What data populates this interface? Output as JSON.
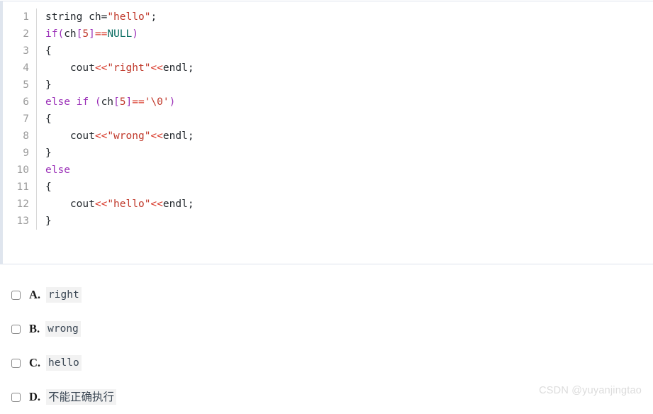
{
  "code_block": {
    "language": "cpp",
    "line_numbers": [
      "1",
      "2",
      "3",
      "4",
      "5",
      "6",
      "7",
      "8",
      "9",
      "10",
      "11",
      "12",
      "13"
    ],
    "lines": [
      {
        "number": "1",
        "text": "string ch=\"hello\";",
        "tokens": [
          {
            "t": "string",
            "c": "plain"
          },
          {
            "t": " ch",
            "c": "plain"
          },
          {
            "t": "=",
            "c": "plain"
          },
          {
            "t": "\"hello\"",
            "c": "str"
          },
          {
            "t": ";",
            "c": "plain"
          }
        ]
      },
      {
        "number": "2",
        "text": "if(ch[5]==NULL)",
        "tokens": [
          {
            "t": "if",
            "c": "kw"
          },
          {
            "t": "(",
            "c": "punc"
          },
          {
            "t": "ch",
            "c": "plain"
          },
          {
            "t": "[",
            "c": "punc"
          },
          {
            "t": "5",
            "c": "num"
          },
          {
            "t": "]",
            "c": "punc"
          },
          {
            "t": "==",
            "c": "op"
          },
          {
            "t": "NULL",
            "c": "const"
          },
          {
            "t": ")",
            "c": "punc"
          }
        ]
      },
      {
        "number": "3",
        "text": "{",
        "tokens": [
          {
            "t": "{",
            "c": "plain"
          }
        ]
      },
      {
        "number": "4",
        "text": "    cout<<\"right\"<<endl;",
        "tokens": [
          {
            "t": "    cout",
            "c": "plain"
          },
          {
            "t": "<<",
            "c": "op"
          },
          {
            "t": "\"right\"",
            "c": "str"
          },
          {
            "t": "<<",
            "c": "op"
          },
          {
            "t": "endl",
            "c": "plain"
          },
          {
            "t": ";",
            "c": "plain"
          }
        ]
      },
      {
        "number": "5",
        "text": "}",
        "tokens": [
          {
            "t": "}",
            "c": "plain"
          }
        ]
      },
      {
        "number": "6",
        "text": "else if (ch[5]=='\\0')",
        "tokens": [
          {
            "t": "else if",
            "c": "kw"
          },
          {
            "t": " ",
            "c": "plain"
          },
          {
            "t": "(",
            "c": "punc"
          },
          {
            "t": "ch",
            "c": "plain"
          },
          {
            "t": "[",
            "c": "punc"
          },
          {
            "t": "5",
            "c": "num"
          },
          {
            "t": "]",
            "c": "punc"
          },
          {
            "t": "==",
            "c": "op"
          },
          {
            "t": "'\\0'",
            "c": "str"
          },
          {
            "t": ")",
            "c": "punc"
          }
        ]
      },
      {
        "number": "7",
        "text": "{",
        "tokens": [
          {
            "t": "{",
            "c": "plain"
          }
        ]
      },
      {
        "number": "8",
        "text": "    cout<<\"wrong\"<<endl;",
        "tokens": [
          {
            "t": "    cout",
            "c": "plain"
          },
          {
            "t": "<<",
            "c": "op"
          },
          {
            "t": "\"wrong\"",
            "c": "str"
          },
          {
            "t": "<<",
            "c": "op"
          },
          {
            "t": "endl",
            "c": "plain"
          },
          {
            "t": ";",
            "c": "plain"
          }
        ]
      },
      {
        "number": "9",
        "text": "}",
        "tokens": [
          {
            "t": "}",
            "c": "plain"
          }
        ]
      },
      {
        "number": "10",
        "text": "else",
        "tokens": [
          {
            "t": "else",
            "c": "kw"
          }
        ]
      },
      {
        "number": "11",
        "text": "{",
        "tokens": [
          {
            "t": "{",
            "c": "plain"
          }
        ]
      },
      {
        "number": "12",
        "text": "    cout<<\"hello\"<<endl;",
        "tokens": [
          {
            "t": "    cout",
            "c": "plain"
          },
          {
            "t": "<<",
            "c": "op"
          },
          {
            "t": "\"hello\"",
            "c": "str"
          },
          {
            "t": "<<",
            "c": "op"
          },
          {
            "t": "endl",
            "c": "plain"
          },
          {
            "t": ";",
            "c": "plain"
          }
        ]
      },
      {
        "number": "13",
        "text": "}",
        "tokens": [
          {
            "t": "}",
            "c": "plain"
          }
        ]
      }
    ]
  },
  "options": [
    {
      "letter": "A.",
      "text": "right",
      "checked": false,
      "cjk": false
    },
    {
      "letter": "B.",
      "text": "wrong",
      "checked": false,
      "cjk": false
    },
    {
      "letter": "C.",
      "text": "hello",
      "checked": false,
      "cjk": false
    },
    {
      "letter": "D.",
      "text": "不能正确执行",
      "checked": false,
      "cjk": true
    }
  ],
  "watermark": {
    "text": "CSDN @yuyanjingtao"
  },
  "colors": {
    "keyword": "#9b30b8",
    "string": "#c0392b",
    "number": "#c0392b",
    "operator": "#d93a2b",
    "constant": "#0b6e63",
    "plain": "#24292e",
    "line_number": "#9b9b9b",
    "block_border": "#dde3ec",
    "option_highlight": "#f2f2f2",
    "watermark": "#dcdcdc"
  }
}
